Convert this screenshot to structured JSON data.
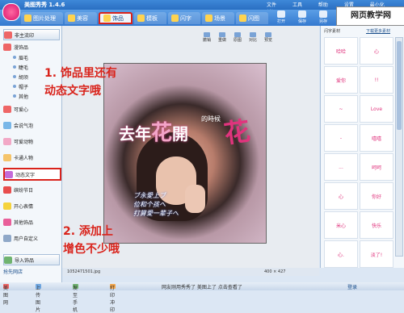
{
  "window": {
    "title": "美图秀秀 1.4.6",
    "menu": [
      "文件",
      "工具",
      "帮助",
      "设置",
      "最小化",
      "关闭"
    ]
  },
  "watermark": "网页教学网",
  "tabs": [
    {
      "label": "图片处理",
      "active": false
    },
    {
      "label": "美容",
      "active": false
    },
    {
      "label": "饰品",
      "active": true
    },
    {
      "label": "模板",
      "active": false
    },
    {
      "label": "闪字",
      "active": false
    },
    {
      "label": "场景",
      "active": false
    },
    {
      "label": "闪图",
      "active": false
    }
  ],
  "toolbar": [
    "打开",
    "保存",
    "另存",
    "上传",
    "分享"
  ],
  "canvas_tools": [
    "撤销",
    "重做",
    "原图",
    "对比",
    "预览"
  ],
  "left_panel": {
    "header": "非主流印",
    "items": [
      {
        "label": "漫饰品",
        "sub": false
      },
      {
        "label": "眉毛",
        "sub": true
      },
      {
        "label": "睫毛",
        "sub": true
      },
      {
        "label": "胡须",
        "sub": true
      },
      {
        "label": "帽子",
        "sub": true
      },
      {
        "label": "其他",
        "sub": true
      },
      {
        "label": "可爱心",
        "sub": false
      },
      {
        "label": "会说气泡",
        "sub": false
      },
      {
        "label": "可爱动物",
        "sub": false
      },
      {
        "label": "卡通人物",
        "sub": false
      },
      {
        "label": "动态文字",
        "sub": false,
        "boxed": true
      },
      {
        "label": "缤纷节日",
        "sub": false
      },
      {
        "label": "开心表情",
        "sub": false
      },
      {
        "label": "其他饰品",
        "sub": false
      },
      {
        "label": "用户自定义",
        "sub": false
      },
      {
        "label": "导入饰品",
        "sub": false
      }
    ],
    "footer": "抢先网店"
  },
  "annotations": {
    "note1_line1": "1. 饰品里还有",
    "note1_line2": "动态文字哦",
    "note2_line1": "2. 添加上",
    "note2_line2": "增色不少哦"
  },
  "photo_text": {
    "title_left": "去年",
    "title_flower": "花",
    "title_right": "開",
    "small": "的時候",
    "big_flower": "花",
    "quote_lines": [
      "ブ永愛上ブ",
      "位和个孩へ",
      "打算愛一辈子へ"
    ]
  },
  "right_panel": {
    "tab1": "闪字素材",
    "tab2": "下载更多素材",
    "stickers": [
      "哈哈",
      "心",
      "爱你",
      "!!",
      "~",
      "Love",
      "-",
      "嘻嘻",
      "...",
      "呵呵",
      "心",
      "你好",
      "米心",
      "快乐",
      "心.",
      "淡了!"
    ]
  },
  "size_bar": {
    "left": "1052471501.jpg",
    "right": "400 × 427"
  },
  "status": {
    "item1": "美图网",
    "item2": "上传图片",
    "item3": "发至手机",
    "item4": "打印冲印",
    "notice": "网友刚用秀秀了 美图上了 点击查看了",
    "login": "登录"
  }
}
